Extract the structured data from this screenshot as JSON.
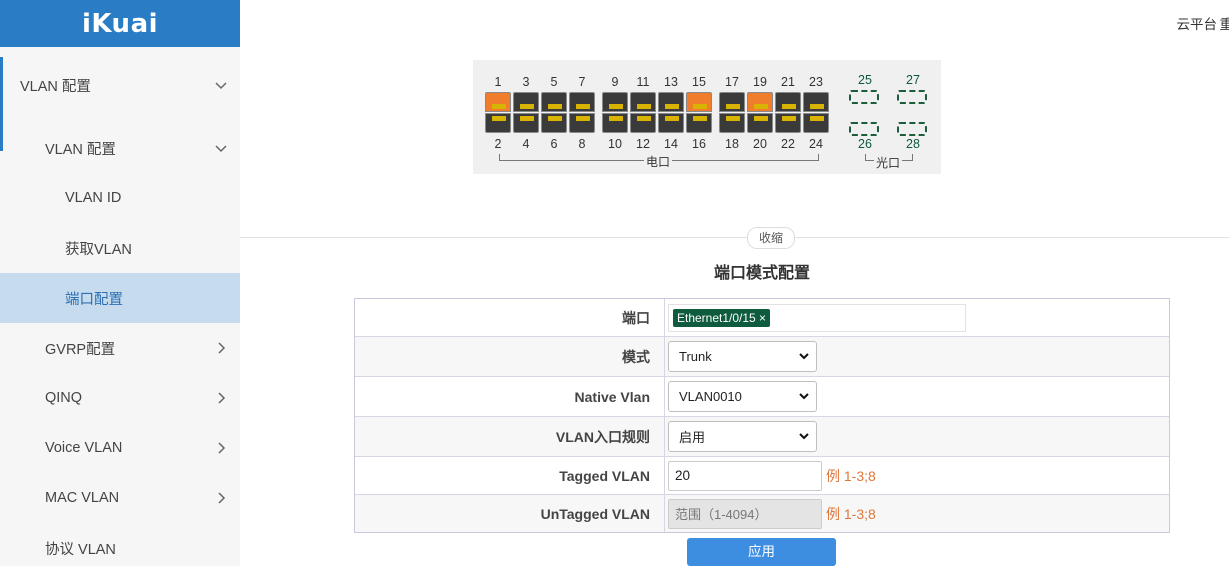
{
  "brand": {
    "logo_text": "iKuai"
  },
  "topbar": {
    "cloud_label": "云平台",
    "extra_label": "重"
  },
  "sidebar": {
    "items": [
      {
        "label": "VLAN 配置"
      },
      {
        "label": "VLAN 配置"
      },
      {
        "label": "VLAN ID"
      },
      {
        "label": "获取VLAN"
      },
      {
        "label": "端口配置"
      },
      {
        "label": "GVRP配置"
      },
      {
        "label": "QINQ"
      },
      {
        "label": "Voice VLAN"
      },
      {
        "label": "MAC VLAN"
      },
      {
        "label": "协议 VLAN"
      }
    ]
  },
  "switch_panel": {
    "top_ports": [
      "1",
      "3",
      "5",
      "7",
      "9",
      "11",
      "13",
      "15",
      "17",
      "19",
      "21",
      "23"
    ],
    "bottom_ports": [
      "2",
      "4",
      "6",
      "8",
      "10",
      "12",
      "14",
      "16",
      "18",
      "20",
      "22",
      "24"
    ],
    "fiber_top": [
      "25",
      "27"
    ],
    "fiber_bottom": [
      "26",
      "28"
    ],
    "active_ports": [
      1,
      15,
      19
    ],
    "electric_label": "电口",
    "fiber_label": "光口",
    "active_color": "#f07d2b"
  },
  "collapse_label": "收缩",
  "form": {
    "title": "端口模式配置",
    "port_label": "端口",
    "port_tag": "Ethernet1/0/15 ×",
    "mode_label": "模式",
    "mode_value": "Trunk",
    "native_label": "Native Vlan",
    "native_value": "VLAN0010",
    "ingress_label": "VLAN入口规则",
    "ingress_value": "启用",
    "tagged_label": "Tagged VLAN",
    "tagged_value": "20",
    "tagged_hint": "例 1-3;8",
    "untagged_label": "UnTagged VLAN",
    "untagged_placeholder": "范围（1-4094）",
    "untagged_hint": "例 1-3;8"
  },
  "apply_label": "应用",
  "colors": {
    "brand": "#2a7dc4",
    "selected_bg": "#c6dbee",
    "tag_bg": "#0e5b3d",
    "hint": "#e0773a",
    "button": "#3d8ee0"
  }
}
